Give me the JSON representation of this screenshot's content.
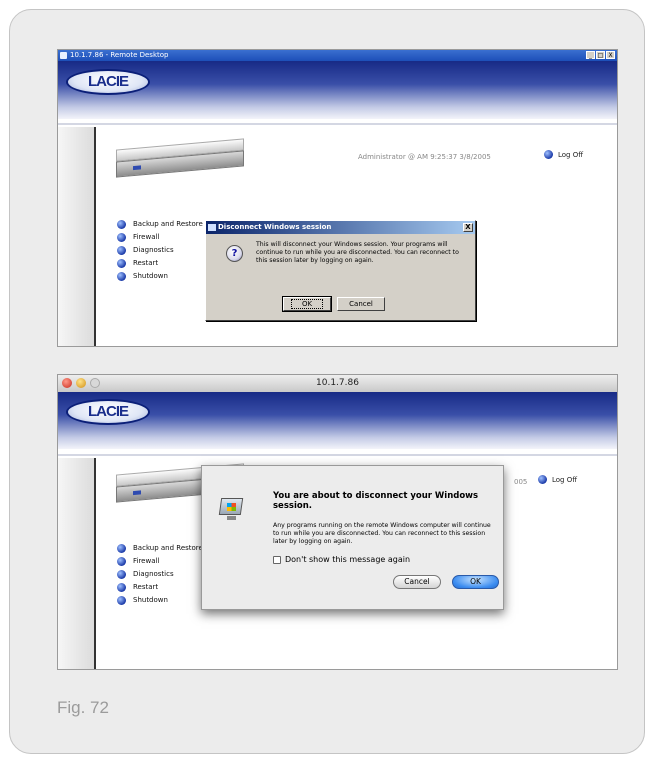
{
  "screenshot1": {
    "window_title": "10.1.7.86 - Remote Desktop",
    "window_controls": [
      "_",
      "□",
      "X"
    ],
    "logo_text": "LACIE",
    "admin_line": "Administrator @   AM 9:25:37  3/8/2005",
    "logoff_label": "Log Off",
    "menu_items": [
      "Backup and Restore",
      "Firewall",
      "Diagnostics",
      "Restart",
      "Shutdown"
    ],
    "dialog": {
      "title": "Disconnect Windows session",
      "close_label": "X",
      "icon": "question-icon",
      "message": "This will disconnect your Windows session. Your programs will continue to run while you are disconnected. You can reconnect to this session later by logging on again.",
      "ok_label": "OK",
      "cancel_label": "Cancel"
    }
  },
  "screenshot2": {
    "window_title": "10.1.7.86",
    "logo_text": "LACIE",
    "date_fragment": "005",
    "logoff_label": "Log Off",
    "menu_items": [
      "Backup and Restore",
      "Firewall",
      "Diagnostics",
      "Restart",
      "Shutdown"
    ],
    "dialog": {
      "title": "You are about to disconnect your Windows session.",
      "message": "Any programs running on the remote Windows computer will continue to run while you are disconnected.  You can reconnect to this session later by logging on again.",
      "checkbox_label": "Don't show this message again",
      "checkbox_checked": false,
      "cancel_label": "Cancel",
      "ok_label": "OK",
      "icon": "remote-desktop-icon"
    }
  },
  "caption": "Fig. 72"
}
